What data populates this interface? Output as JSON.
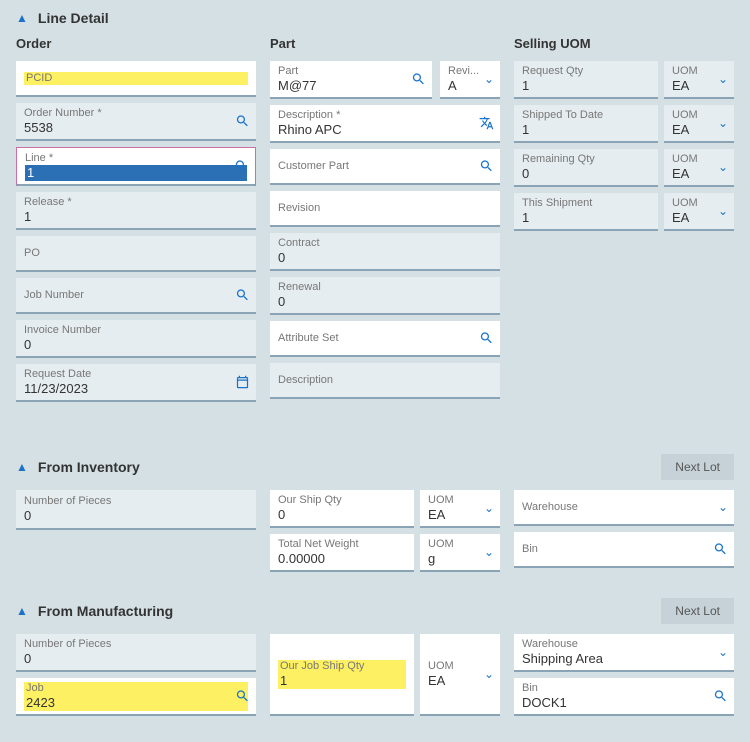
{
  "lineDetail": {
    "title": "Line Detail"
  },
  "order": {
    "title": "Order",
    "pcid": {
      "label": "PCID",
      "value": ""
    },
    "orderNumber": {
      "label": "Order Number *",
      "value": "5538"
    },
    "line": {
      "label": "Line *",
      "value": "1"
    },
    "release": {
      "label": "Release *",
      "value": "1"
    },
    "po": {
      "label": "PO",
      "value": ""
    },
    "jobNumber": {
      "label": "Job Number",
      "value": ""
    },
    "invoiceNumber": {
      "label": "Invoice Number",
      "value": "0"
    },
    "requestDate": {
      "label": "Request Date",
      "value": "11/23/2023"
    }
  },
  "part": {
    "title": "Part",
    "part": {
      "label": "Part",
      "value": "M@77"
    },
    "revi": {
      "label": "Revi...",
      "value": "A"
    },
    "description": {
      "label": "Description *",
      "value": "Rhino APC"
    },
    "customerPart": {
      "label": "Customer Part",
      "value": ""
    },
    "revision": {
      "label": "Revision",
      "value": ""
    },
    "contract": {
      "label": "Contract",
      "value": "0"
    },
    "renewal": {
      "label": "Renewal",
      "value": "0"
    },
    "attributeSet": {
      "label": "Attribute Set",
      "value": ""
    },
    "description2": {
      "label": "Description",
      "value": ""
    }
  },
  "sellingUOM": {
    "title": "Selling UOM",
    "requestQty": {
      "label": "Request Qty",
      "value": "1",
      "uomLabel": "UOM",
      "uom": "EA"
    },
    "shippedToDate": {
      "label": "Shipped To Date",
      "value": "1",
      "uomLabel": "UOM",
      "uom": "EA"
    },
    "remainingQty": {
      "label": "Remaining Qty",
      "value": "0",
      "uomLabel": "UOM",
      "uom": "EA"
    },
    "thisShipment": {
      "label": "This Shipment",
      "value": "1",
      "uomLabel": "UOM",
      "uom": "EA"
    }
  },
  "fromInventory": {
    "title": "From Inventory",
    "nextLot": "Next Lot",
    "numberOfPieces": {
      "label": "Number of Pieces",
      "value": "0"
    },
    "ourShipQty": {
      "label": "Our Ship Qty",
      "value": "0"
    },
    "uom1": {
      "label": "UOM",
      "value": "EA"
    },
    "totalNetWeight": {
      "label": "Total Net Weight",
      "value": "0.00000"
    },
    "uom2": {
      "label": "UOM",
      "value": "g"
    },
    "warehouse": {
      "label": "Warehouse",
      "value": ""
    },
    "bin": {
      "label": "Bin",
      "value": ""
    }
  },
  "fromManufacturing": {
    "title": "From Manufacturing",
    "nextLot": "Next Lot",
    "numberOfPieces": {
      "label": "Number of Pieces",
      "value": "0"
    },
    "job": {
      "label": "Job",
      "value": "2423"
    },
    "ourJobShipQty": {
      "label": "Our Job Ship Qty",
      "value": "1"
    },
    "uom": {
      "label": "UOM",
      "value": "EA"
    },
    "warehouse": {
      "label": "Warehouse",
      "value": "Shipping Area"
    },
    "bin": {
      "label": "Bin",
      "value": "DOCK1"
    }
  }
}
